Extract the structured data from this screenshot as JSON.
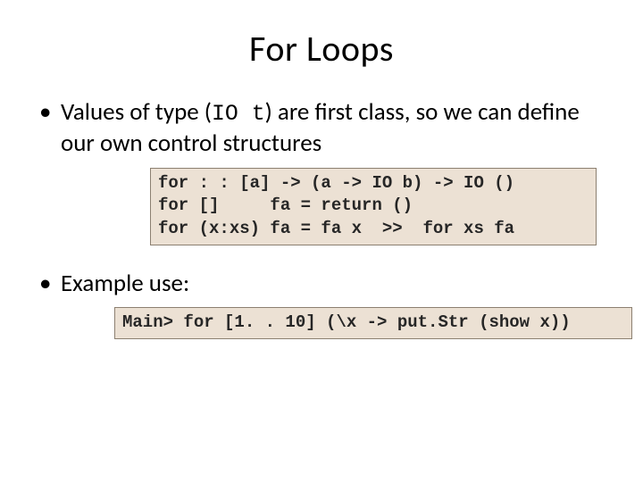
{
  "title": "For Loops",
  "bullets": {
    "b1_pre": "Values of type (",
    "b1_code": "IO t",
    "b1_post": ") are first class, so we can define our own control structures",
    "b2": "Example use:"
  },
  "code1": "for : : [a] -> (a -> IO b) -> IO ()\nfor []     fa = return ()\nfor (x:xs) fa = fa x  >>  for xs fa",
  "code2": "Main> for [1. . 10] (\\x -> put.Str (show x))"
}
